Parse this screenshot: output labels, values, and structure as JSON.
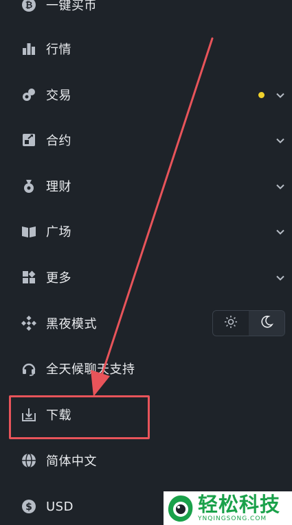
{
  "menu": {
    "items": [
      {
        "label": "一键买币",
        "icon": "bitcoin-icon"
      },
      {
        "label": "行情",
        "icon": "bar-chart-icon"
      },
      {
        "label": "交易",
        "icon": "trade-icon",
        "has_dot": true,
        "has_chevron": true
      },
      {
        "label": "合约",
        "icon": "futures-icon",
        "has_chevron": true
      },
      {
        "label": "理财",
        "icon": "money-bag-icon",
        "has_chevron": true
      },
      {
        "label": "广场",
        "icon": "book-icon",
        "has_chevron": true
      },
      {
        "label": "更多",
        "icon": "grid-icon",
        "has_chevron": true
      },
      {
        "label": "黑夜模式",
        "icon": "binance-logo-icon"
      },
      {
        "label": "全天候聊天支持",
        "icon": "headset-icon"
      },
      {
        "label": "下载",
        "icon": "download-icon"
      },
      {
        "label": "简体中文",
        "icon": "globe-icon"
      },
      {
        "label": "USD",
        "icon": "dollar-icon"
      }
    ]
  },
  "theme_toggle": {
    "options": [
      "sun-icon",
      "moon-icon"
    ],
    "selected": "moon-icon"
  },
  "colors": {
    "background": "#1e2329",
    "text": "#eaecef",
    "accent_dot": "#f0d12c",
    "annotation": "#e8545a"
  },
  "watermark": {
    "title": "轻松科技",
    "subtitle": "YNQINGSONG.COM"
  }
}
